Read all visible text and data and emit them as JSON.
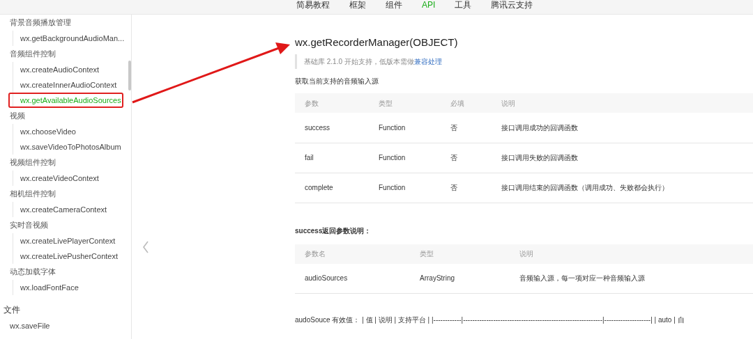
{
  "nav": [
    {
      "label": "简易教程",
      "selected": false
    },
    {
      "label": "框架",
      "selected": false
    },
    {
      "label": "组件",
      "selected": false
    },
    {
      "label": "API",
      "selected": true
    },
    {
      "label": "工具",
      "selected": false
    },
    {
      "label": "腾讯云支持",
      "selected": false
    }
  ],
  "sidebar": {
    "items": [
      {
        "kind": "group",
        "label": "背景音频播放管理",
        "children": [
          {
            "label": "wx.getBackgroundAudioMan...",
            "selected": false
          }
        ]
      },
      {
        "kind": "group",
        "label": "音频组件控制",
        "children": [
          {
            "label": "wx.createAudioContext",
            "selected": false
          },
          {
            "label": "wx.createInnerAudioContext",
            "selected": false
          },
          {
            "label": "wx.getAvailableAudioSources",
            "selected": true
          }
        ]
      },
      {
        "kind": "group",
        "label": "视频",
        "children": [
          {
            "label": "wx.chooseVideo",
            "selected": false
          },
          {
            "label": "wx.saveVideoToPhotosAlbum",
            "selected": false
          }
        ]
      },
      {
        "kind": "group",
        "label": "视频组件控制",
        "children": [
          {
            "label": "wx.createVideoContext",
            "selected": false
          }
        ]
      },
      {
        "kind": "group",
        "label": "相机组件控制",
        "children": [
          {
            "label": "wx.createCameraContext",
            "selected": false
          }
        ]
      },
      {
        "kind": "group",
        "label": "实时音视频",
        "children": [
          {
            "label": "wx.createLivePlayerContext",
            "selected": false
          },
          {
            "label": "wx.createLivePusherContext",
            "selected": false
          }
        ]
      },
      {
        "kind": "group",
        "label": "动态加载字体",
        "children": [
          {
            "label": "wx.loadFontFace",
            "selected": false
          }
        ]
      },
      {
        "kind": "section",
        "label": "文件"
      },
      {
        "kind": "link",
        "label": "wx.saveFile",
        "selected": false
      }
    ]
  },
  "content": {
    "title": "wx.getRecorderManager(OBJECT)",
    "note": {
      "text": "基础库 2.1.0 开始支持，低版本需做",
      "link": "兼容处理"
    },
    "description": "获取当前支持的音频输入源",
    "params_table": {
      "columns": [
        "参数",
        "类型",
        "必填",
        "说明"
      ],
      "rows": [
        [
          "success",
          "Function",
          "否",
          "接口调用成功的回调函数"
        ],
        [
          "fail",
          "Function",
          "否",
          "接口调用失败的回调函数"
        ],
        [
          "complete",
          "Function",
          "否",
          "接口调用结束的回调函数（调用成功、失败都会执行）"
        ]
      ]
    },
    "return_heading": "success返回参数说明：",
    "return_table": {
      "columns": [
        "参数名",
        "类型",
        "说明"
      ],
      "rows": [
        [
          "audioSources",
          "ArrayString",
          "音频输入源，每一项对应一种音频输入源"
        ]
      ]
    },
    "values_text": "audoSouce 有效值：  | 值 | 说明 | 支持平台 | |------------|------------------------------------------------------------|--------------------| | auto | 自"
  }
}
